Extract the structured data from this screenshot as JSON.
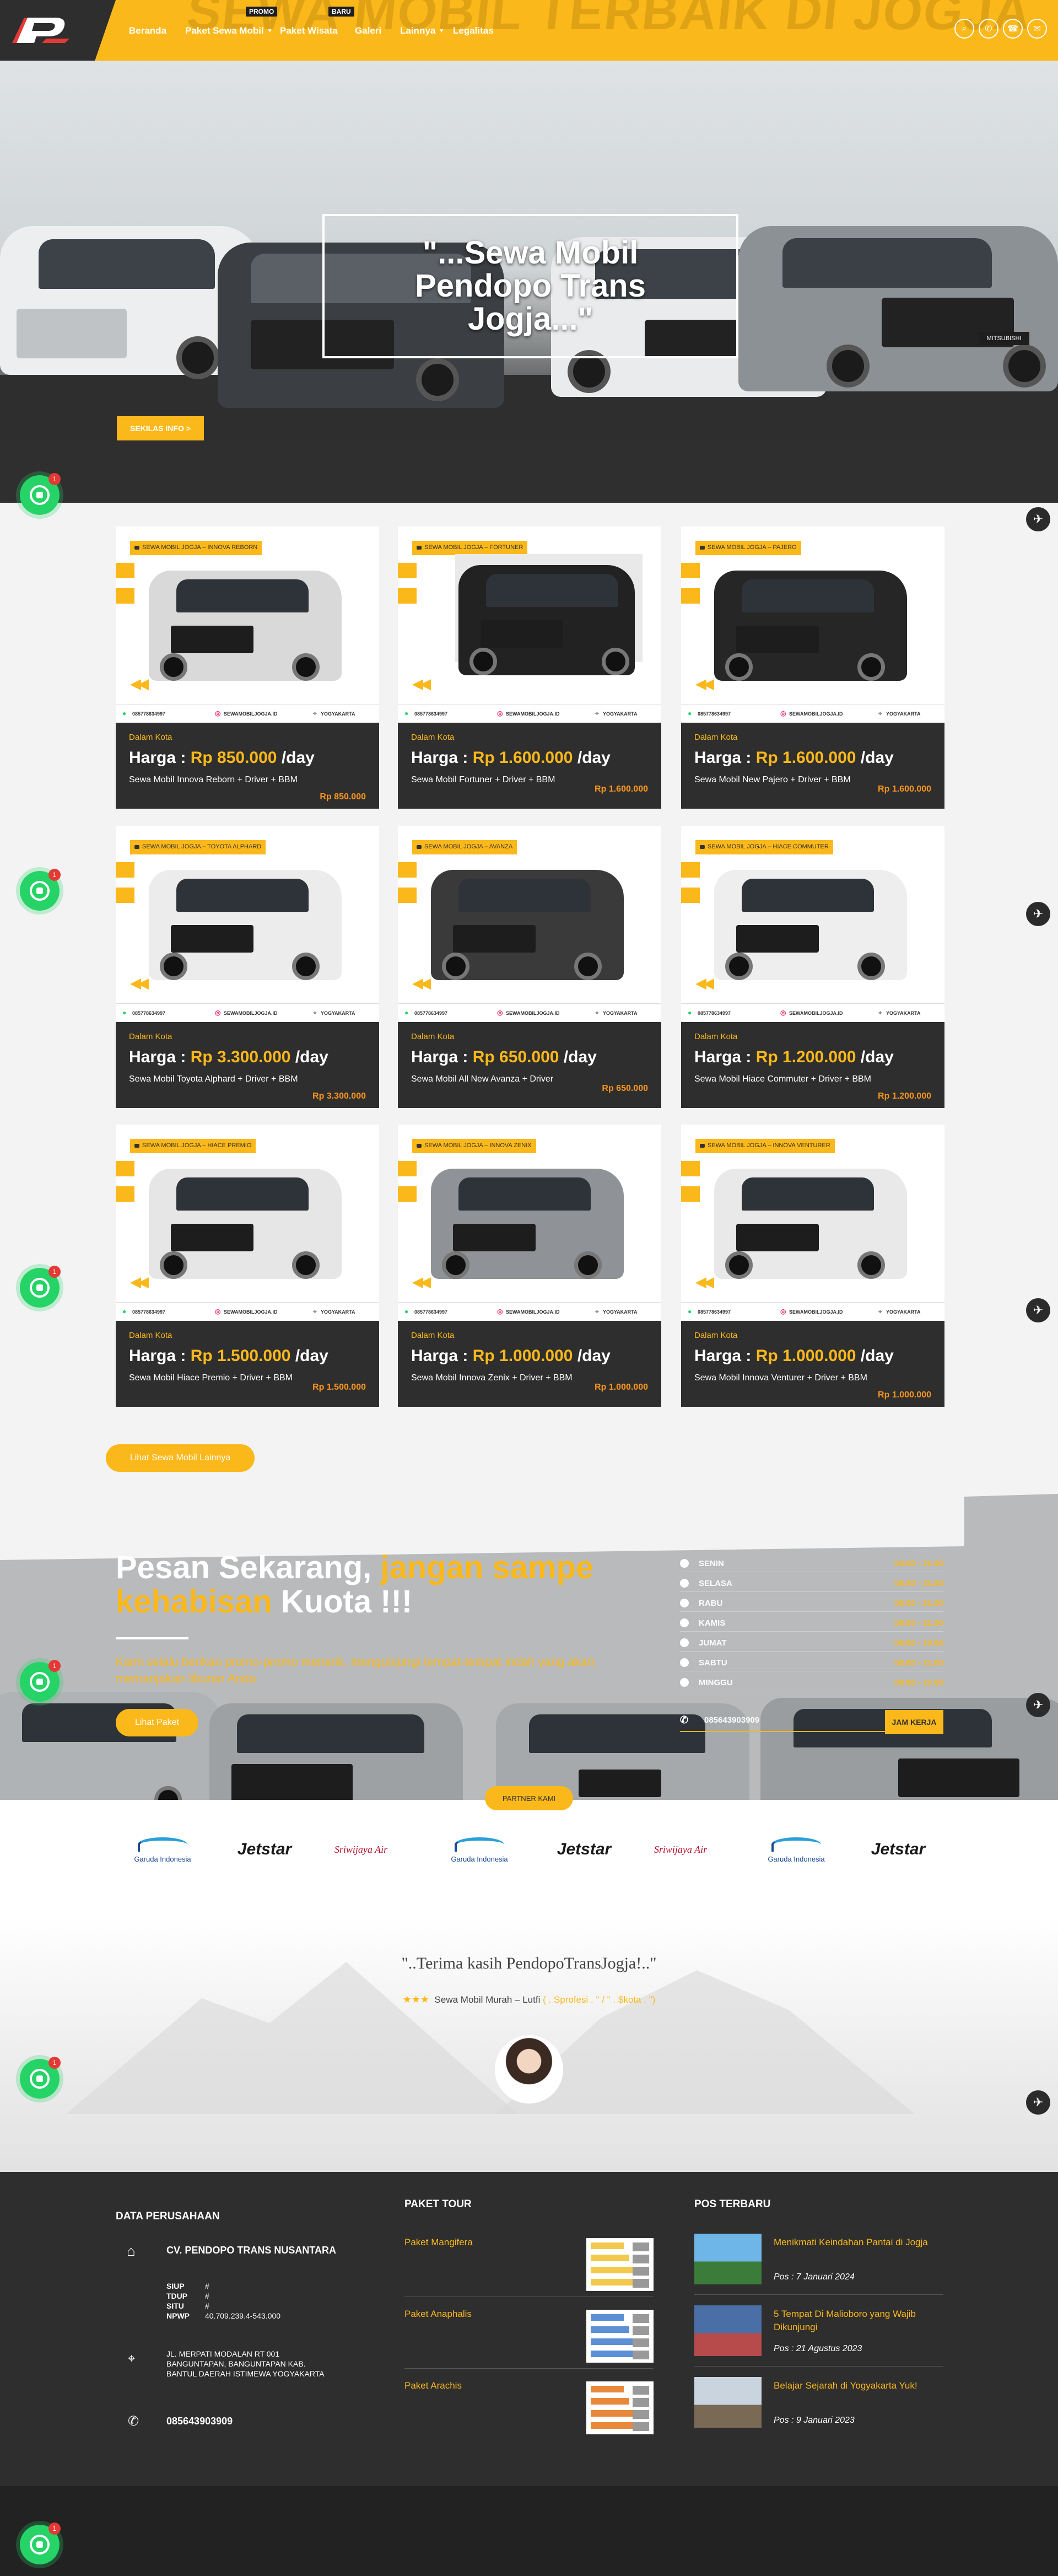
{
  "header": {
    "bg_title": "SEWA MOBIL TERBAIK DI JOGJA",
    "nav": [
      {
        "label": "Beranda",
        "tag": ""
      },
      {
        "label": "Paket Sewa Mobil",
        "tag": "PROMO"
      },
      {
        "label": "Paket Wisata",
        "tag": "BARU"
      },
      {
        "label": "Galeri",
        "tag": ""
      },
      {
        "label": "Lainnya",
        "tag": ""
      },
      {
        "label": "Legalitas",
        "tag": ""
      }
    ],
    "icons": [
      "search-icon",
      "whatsapp-icon",
      "phone-icon",
      "mail-icon"
    ],
    "accent": "#fbb81b",
    "dark": "#2e2e2e"
  },
  "hero": {
    "headline": "\"...Sewa Mobil Pendopo Trans Jogja...\"",
    "info_tag": "SEKILAS INFO >",
    "plate": "MITSUBISHI"
  },
  "cars": [
    {
      "label": "SEWA MOBIL JOGJA – INNOVA REBORN",
      "loc": "Dalam Kota",
      "price_prefix": "Harga : ",
      "price": "Rp 850.000",
      "per": " /day",
      "desc": "Sewa Mobil Innova Reborn + Driver + BBM",
      "right_price": "Rp 850.000",
      "color": "#d9d9d9"
    },
    {
      "label": "SEWA MOBIL JOGJA – FORTUNER",
      "loc": "Dalam Kota",
      "price_prefix": "Harga : ",
      "price": "Rp 1.600.000",
      "per": " /day",
      "desc": "Sewa Mobil Fortuner + Driver + BBM",
      "right_price": "Rp 1.600.000",
      "color": "#222222"
    },
    {
      "label": "SEWA MOBIL JOGJA – PAJERO",
      "loc": "Dalam Kota",
      "price_prefix": "Harga : ",
      "price": "Rp 1.600.000",
      "per": " /day",
      "desc": "Sewa Mobil New Pajero + Driver + BBM",
      "right_price": "Rp 1.600.000",
      "color": "#262626"
    },
    {
      "label": "SEWA MOBIL JOGJA – TOYOTA ALPHARD",
      "loc": "Dalam Kota",
      "price_prefix": "Harga : ",
      "price": "Rp 3.300.000",
      "per": " /day",
      "desc": "Sewa Mobil Toyota Alphard + Driver + BBM",
      "right_price": "Rp 3.300.000",
      "color": "#ececec"
    },
    {
      "label": "SEWA MOBIL JOGJA – AVANZA",
      "loc": "Dalam Kota",
      "price_prefix": "Harga : ",
      "price": "Rp 650.000",
      "per": " /day",
      "desc": "Sewa Mobil All New Avanza + Driver",
      "right_price": "Rp 650.000",
      "color": "#3a3a3a"
    },
    {
      "label": "SEWA MOBIL JOGJA – HIACE COMMUTER",
      "loc": "Dalam Kota",
      "price_prefix": "Harga : ",
      "price": "Rp 1.200.000",
      "per": " /day",
      "desc": "Sewa Mobil Hiace Commuter + Driver + BBM",
      "right_price": "Rp 1.200.000",
      "color": "#eeeeee"
    },
    {
      "label": "SEWA MOBIL JOGJA – HIACE PREMIO",
      "loc": "Dalam Kota",
      "price_prefix": "Harga : ",
      "price": "Rp 1.500.000",
      "per": " /day",
      "desc": "Sewa Mobil Hiace Premio + Driver + BBM",
      "right_price": "Rp 1.500.000",
      "color": "#e6e6e6"
    },
    {
      "label": "SEWA MOBIL JOGJA – INNOVA ZENIX",
      "loc": "Dalam Kota",
      "price_prefix": "Harga : ",
      "price": "Rp 1.000.000",
      "per": " /day",
      "desc": "Sewa Mobil Innova Zenix + Driver + BBM",
      "right_price": "Rp 1.000.000",
      "color": "#8f9296"
    },
    {
      "label": "SEWA MOBIL JOGJA – INNOVA VENTURER",
      "loc": "Dalam Kota",
      "price_prefix": "Harga : ",
      "price": "Rp 1.000.000",
      "per": " /day",
      "desc": "Sewa Mobil Innova Venturer + Driver + BBM",
      "right_price": "Rp 1.000.000",
      "color": "#e9e9e9"
    }
  ],
  "card_footer": {
    "phone": "085778634997",
    "ig": "SEWAMOBILJOGJA.ID",
    "city": "YOGYAKARTA"
  },
  "more_button": "Lihat Sewa Mobil Lainnya",
  "promo": {
    "title_a": "Pesan Sekarang, ",
    "title_b": "jangan sampe kehabisan",
    "title_c": " Kuota !!!",
    "sub": "Kami selalu berikan promo-promo menarik, mengunjungi tempat-tempat indah yang akan memanjakan liburan Anda",
    "button": "Lihat Paket",
    "hours": [
      {
        "day": "SENIN",
        "time": "08.00 - 21.00"
      },
      {
        "day": "SELASA",
        "time": "08.00 - 21.00"
      },
      {
        "day": "RABU",
        "time": "08.00 - 21.00"
      },
      {
        "day": "KAMIS",
        "time": "08.00 - 21.00"
      },
      {
        "day": "JUMAT",
        "time": "08.00 - 19.00"
      },
      {
        "day": "SABTU",
        "time": "08.00 - 21.00"
      },
      {
        "day": "MINGGU",
        "time": "08.00 - 22.00"
      }
    ],
    "phone": "085643903909",
    "jam_tag": "JAM KERJA"
  },
  "partners": {
    "tag": "PARTNER KAMI",
    "logos": [
      "Garuda Indonesia",
      "Jetstar",
      "Sriwijaya Air",
      "Garuda Indonesia",
      "Jetstar",
      "Sriwijaya Air",
      "Garuda Indonesia",
      "Jetstar"
    ]
  },
  "testimonial": {
    "quote": "\"..Terima kasih PendopoTransJogja!..\"",
    "stars": "★★★",
    "line": "Sewa Mobil Murah – Lutfi",
    "role": "( . Sprofesi . \" / \" . $kota . \")"
  },
  "footer": {
    "col1_title": "DATA PERUSAHAAN",
    "company": "CV. PENDOPO TRANS NUSANTARA",
    "legal": [
      {
        "k": "SIUP",
        "v": "#"
      },
      {
        "k": "TDUP",
        "v": "#"
      },
      {
        "k": "SITU",
        "v": "#"
      },
      {
        "k": "NPWP",
        "v": "40.709.239.4-543.000"
      }
    ],
    "address": [
      "JL. MERPATI MODALAN RT 001",
      "BANGUNTAPAN, BANGUNTAPAN KAB.",
      "BANTUL DAERAH ISTIMEWA YOGYAKARTA"
    ],
    "phone": "085643903909",
    "col2_title": "PAKET TOUR",
    "tours": [
      "Paket Mangifera",
      "Paket Anaphalis",
      "Paket Arachis"
    ],
    "col3_title": "POS TERBARU",
    "posts": [
      {
        "title": "Menikmati Keindahan Pantai di Jogja",
        "date": "Pos : 7 Januari 2024"
      },
      {
        "title": "5 Tempat Di Malioboro yang Wajib Dikunjungi",
        "date": "Pos : 21 Agustus 2023"
      },
      {
        "title": "Belajar Sejarah di Yogyakarta Yuk!",
        "date": "Pos : 9 Januari 2023"
      }
    ]
  },
  "widgets": {
    "wa_badge": "1"
  }
}
